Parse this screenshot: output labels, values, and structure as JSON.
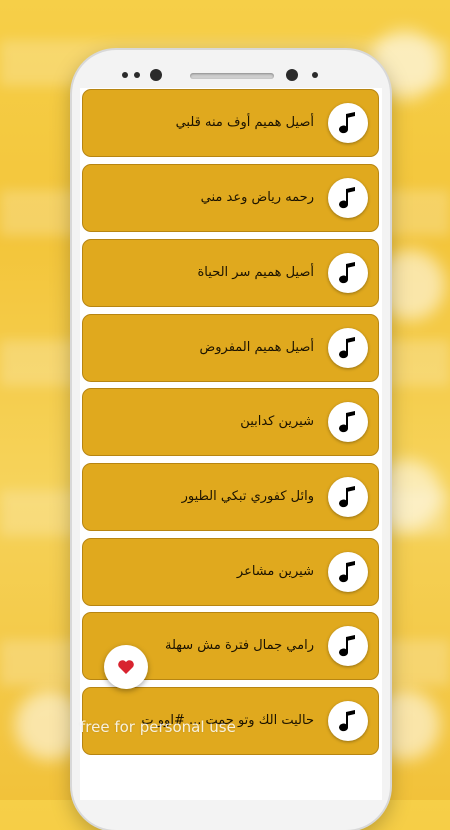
{
  "songs": [
    {
      "title": "أصيل هميم أوف منه قلبي",
      "icon": "music-note-icon"
    },
    {
      "title": "رحمه رياض وعد مني",
      "icon": "music-note-icon"
    },
    {
      "title": "أصيل هميم سر الحياة",
      "icon": "music-note-icon"
    },
    {
      "title": "أصيل هميم المفروض",
      "icon": "music-note-icon"
    },
    {
      "title": "شيرين كدابين",
      "icon": "music-note-icon"
    },
    {
      "title": "وائل كفوري تبكي الطيور",
      "icon": "music-note-icon"
    },
    {
      "title": "شيرين مشاعر",
      "icon": "music-note-icon"
    },
    {
      "title": "رامي جمال فترة مش سهلة",
      "icon": "music-note-icon"
    },
    {
      "title": "حاليت الك وتو حمت ... #اوو ت",
      "icon": "music-note-icon"
    }
  ],
  "fab": {
    "icon": "heart-icon"
  },
  "watermark": "free for personal use",
  "colors": {
    "item_bg": "#e0a91e",
    "item_border": "#b78512",
    "background": "#f3c53a",
    "heart": "#d8232f"
  }
}
